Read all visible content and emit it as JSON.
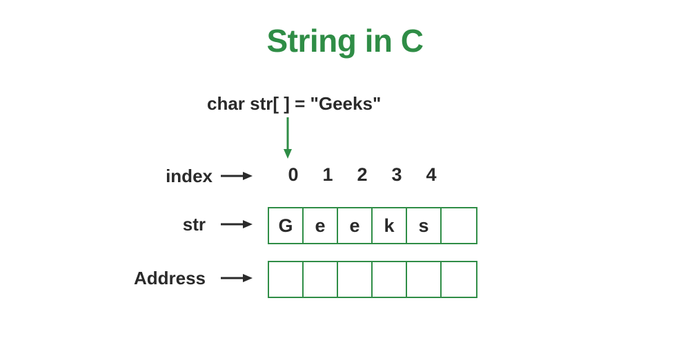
{
  "title": "String in C",
  "declaration": "char str[ ] = \"Geeks\"",
  "labels": {
    "index": "index",
    "str": "str",
    "address": "Address"
  },
  "indices": [
    "0",
    "1",
    "2",
    "3",
    "4"
  ],
  "str_cells": [
    "G",
    "e",
    "e",
    "k",
    "s",
    ""
  ],
  "addr_cells": [
    "",
    "",
    "",
    "",
    "",
    ""
  ],
  "colors": {
    "accent": "#2F8D46",
    "text": "#2a2a2a"
  }
}
